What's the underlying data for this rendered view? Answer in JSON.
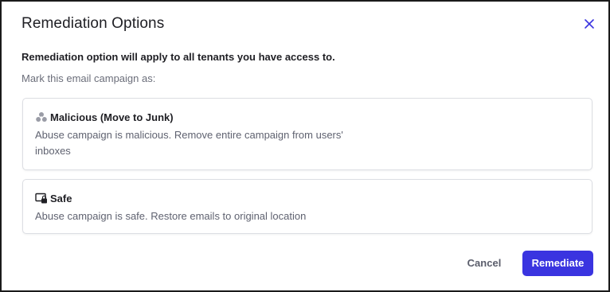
{
  "dialog": {
    "title": "Remediation Options",
    "notice": "Remediation option will apply to all tenants you have access to.",
    "prompt": "Mark this email campaign as:"
  },
  "options": [
    {
      "label": "Malicious (Move to Junk)",
      "description": "Abuse campaign is malicious. Remove entire campaign from users' inboxes",
      "icon": "biohazard-icon"
    },
    {
      "label": "Safe",
      "description": "Abuse campaign is safe. Restore emails to original location",
      "icon": "secure-device-icon"
    }
  ],
  "actions": {
    "cancel_label": "Cancel",
    "remediate_label": "Remediate"
  },
  "colors": {
    "accent": "#3a34e0",
    "close_icon": "#3a34e0",
    "text_primary": "#1f1f24",
    "text_secondary": "#5f6270"
  }
}
